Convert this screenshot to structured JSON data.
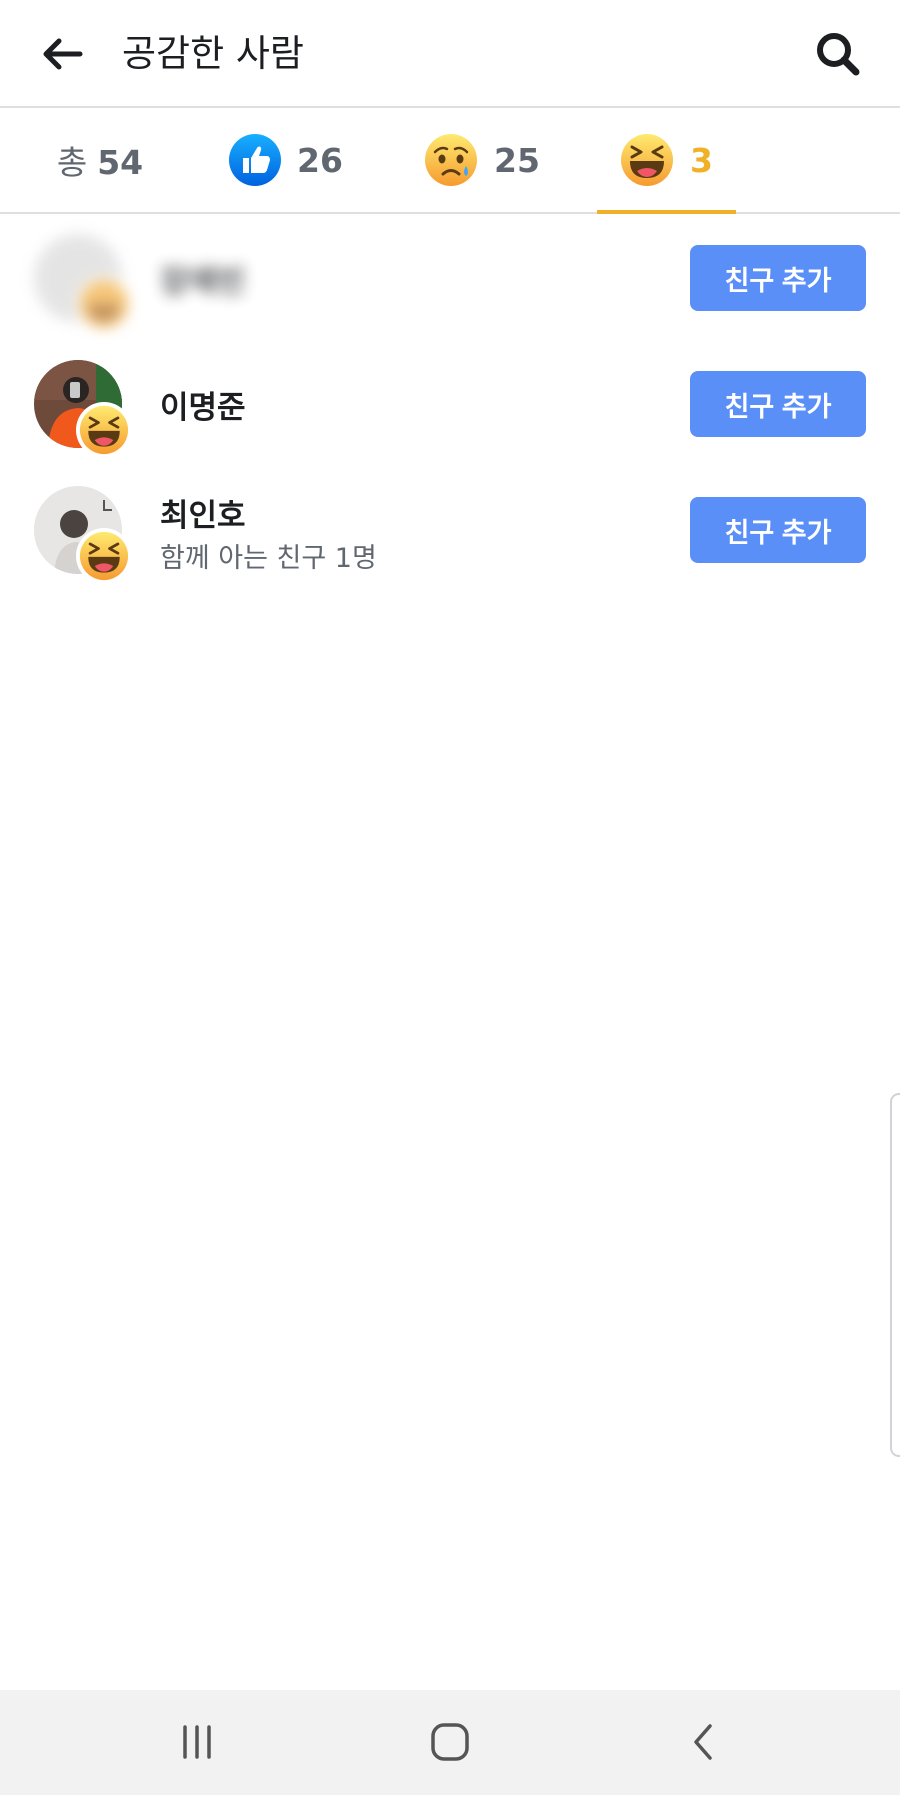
{
  "header": {
    "title": "공감한 사람",
    "back_icon": "arrow-left-icon",
    "search_icon": "search-icon"
  },
  "tabs": [
    {
      "prefix": "총",
      "count": "54",
      "active": false
    },
    {
      "icon": "like-reaction-icon",
      "count": "26",
      "active": false
    },
    {
      "icon": "sad-reaction-icon",
      "count": "25",
      "active": false
    },
    {
      "icon": "haha-reaction-icon",
      "count": "3",
      "active": true
    }
  ],
  "people": [
    {
      "name": "장예빈",
      "subtitle": "",
      "button_label": "친구 추가",
      "blurred": true
    },
    {
      "name": "이명준",
      "subtitle": "",
      "button_label": "친구 추가",
      "blurred": false
    },
    {
      "name": "최인호",
      "subtitle": "함께 아는 친구 1명",
      "button_label": "친구 추가",
      "blurred": false
    }
  ],
  "colors": {
    "accent": "#f0b129",
    "button": "#5b8ff8",
    "like_blue": "#1877f2"
  },
  "nav": [
    "recent-apps-icon",
    "home-icon",
    "back-icon"
  ]
}
